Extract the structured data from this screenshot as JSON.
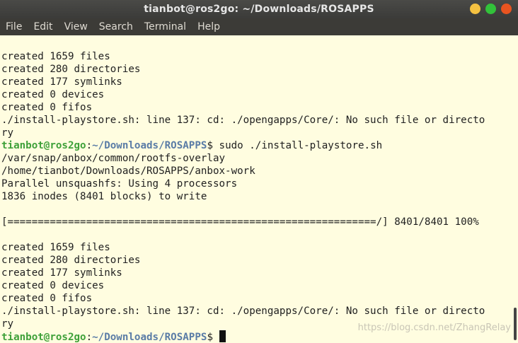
{
  "window": {
    "title": "tianbot@ros2go: ~/Downloads/ROSAPPS"
  },
  "menu": {
    "items": [
      "File",
      "Edit",
      "View",
      "Search",
      "Terminal",
      "Help"
    ]
  },
  "terminal": {
    "lines": [
      {
        "type": "out",
        "text": "created 1659 files"
      },
      {
        "type": "out",
        "text": "created 280 directories"
      },
      {
        "type": "out",
        "text": "created 177 symlinks"
      },
      {
        "type": "out",
        "text": "created 0 devices"
      },
      {
        "type": "out",
        "text": "created 0 fifos"
      },
      {
        "type": "out",
        "text": "./install-playstore.sh: line 137: cd: ./opengapps/Core/: No such file or directo"
      },
      {
        "type": "out",
        "text": "ry"
      },
      {
        "type": "prompt",
        "user": "tianbot@ros2go",
        "sep": ":",
        "path": "~/Downloads/ROSAPPS",
        "sym": "$",
        "cmd": " sudo ./install-playstore.sh"
      },
      {
        "type": "out",
        "text": "/var/snap/anbox/common/rootfs-overlay"
      },
      {
        "type": "out",
        "text": "/home/tianbot/Downloads/ROSAPPS/anbox-work"
      },
      {
        "type": "out",
        "text": "Parallel unsquashfs: Using 4 processors"
      },
      {
        "type": "out",
        "text": "1836 inodes (8401 blocks) to write"
      },
      {
        "type": "out",
        "text": ""
      },
      {
        "type": "out",
        "text": "[=============================================================/] 8401/8401 100%"
      },
      {
        "type": "out",
        "text": ""
      },
      {
        "type": "out",
        "text": "created 1659 files"
      },
      {
        "type": "out",
        "text": "created 280 directories"
      },
      {
        "type": "out",
        "text": "created 177 symlinks"
      },
      {
        "type": "out",
        "text": "created 0 devices"
      },
      {
        "type": "out",
        "text": "created 0 fifos"
      },
      {
        "type": "out",
        "text": "./install-playstore.sh: line 137: cd: ./opengapps/Core/: No such file or directo"
      },
      {
        "type": "out",
        "text": "ry"
      },
      {
        "type": "prompt",
        "user": "tianbot@ros2go",
        "sep": ":",
        "path": "~/Downloads/ROSAPPS",
        "sym": "$",
        "cmd": " ",
        "cursor": true
      }
    ]
  },
  "watermark": "https://blog.csdn.net/ZhangRelay",
  "colors": {
    "background": "#fffde0",
    "user": "#3fa13a",
    "path": "#5a7ca6",
    "titlebar": "#3b3b39",
    "menubar": "#3c3b37"
  }
}
